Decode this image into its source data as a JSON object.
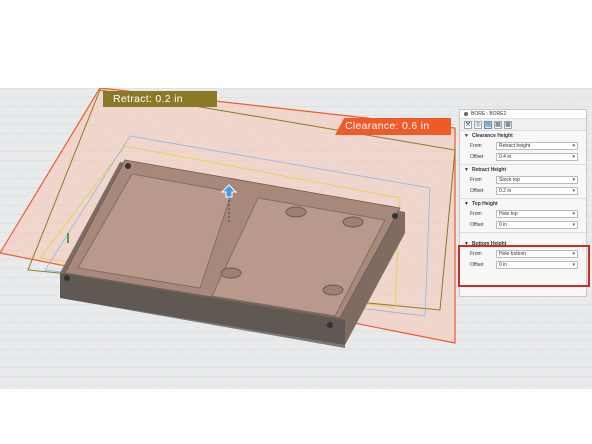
{
  "viewport": {
    "retract_label": "Retract: 0.2 in",
    "clearance_label": "Clearance: 0.6 in"
  },
  "panel": {
    "title": "BORE : BORE2",
    "toolbar_icons": [
      "tool-icon",
      "geometry-icon",
      "heights-icon",
      "passes-icon",
      "linking-icon"
    ],
    "sections": [
      {
        "heading": "Clearance Height",
        "from_label": "From",
        "from_value": "Retract height",
        "offset_label": "Offset",
        "offset_value": "0.4 in"
      },
      {
        "heading": "Retract Height",
        "from_label": "From",
        "from_value": "Stock top",
        "offset_label": "Offset",
        "offset_value": "0.2 in"
      },
      {
        "heading": "Top Height",
        "from_label": "From",
        "from_value": "Hole top",
        "offset_label": "Offset",
        "offset_value": "0 in"
      },
      {
        "heading": "Bottom Height",
        "from_label": "From",
        "from_value": "Hole bottom",
        "offset_label": "Offset",
        "offset_value": "0 in"
      }
    ]
  },
  "colors": {
    "clearance_plane": "#f05a28",
    "retract_plane": "#8a7a28",
    "highlight": "#c82d26"
  }
}
